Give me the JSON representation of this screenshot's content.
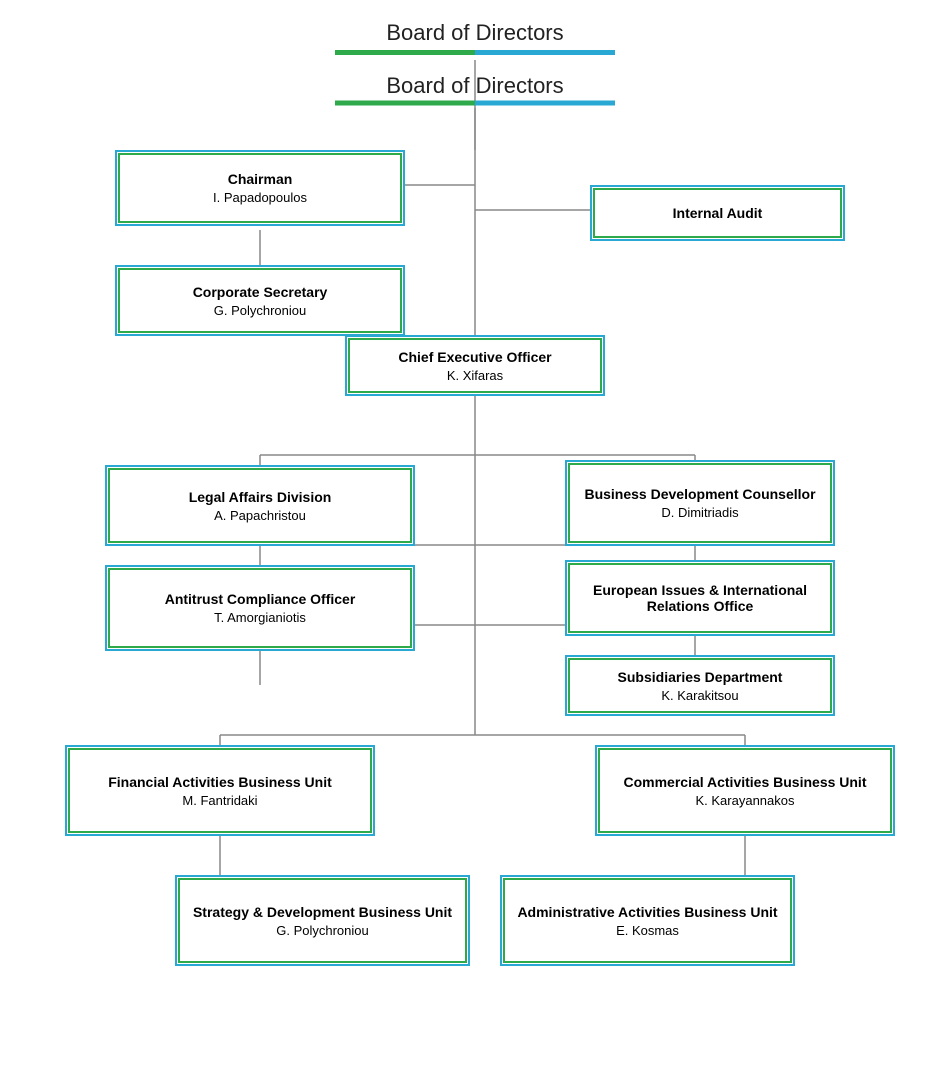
{
  "chart": {
    "title": "Board of Directors",
    "nodes": {
      "board": {
        "label": "Board of Directors"
      },
      "chairman": {
        "title": "Chairman",
        "subtitle": "I. Papadopoulos"
      },
      "internal_audit": {
        "title": "Internal Audit",
        "subtitle": ""
      },
      "corp_secretary": {
        "title": "Corporate Secretary",
        "subtitle": "G. Polychroniou"
      },
      "ceo": {
        "title": "Chief Executive Officer",
        "subtitle": "K. Xifaras"
      },
      "legal": {
        "title": "Legal Affairs Division",
        "subtitle": "A. Papachristou"
      },
      "biz_dev": {
        "title": "Business Development Counsellor",
        "subtitle": "D. Dimitriadis"
      },
      "antitrust": {
        "title": "Antitrust Compliance Officer",
        "subtitle": "T. Amorgianiotis"
      },
      "european": {
        "title": "European Issues & International Relations Office",
        "subtitle": ""
      },
      "subsidiaries": {
        "title": "Subsidiaries Department",
        "subtitle": "K. Karakitsou"
      },
      "financial": {
        "title": "Financial Activities Business Unit",
        "subtitle": "M. Fantridaki"
      },
      "commercial": {
        "title": "Commercial Activities Business Unit",
        "subtitle": "K. Karayannakos"
      },
      "strategy": {
        "title": "Strategy & Development Business Unit",
        "subtitle": "G. Polychroniou"
      },
      "admin": {
        "title": "Administrative Activities Business Unit",
        "subtitle": "E. Kosmas"
      }
    }
  }
}
